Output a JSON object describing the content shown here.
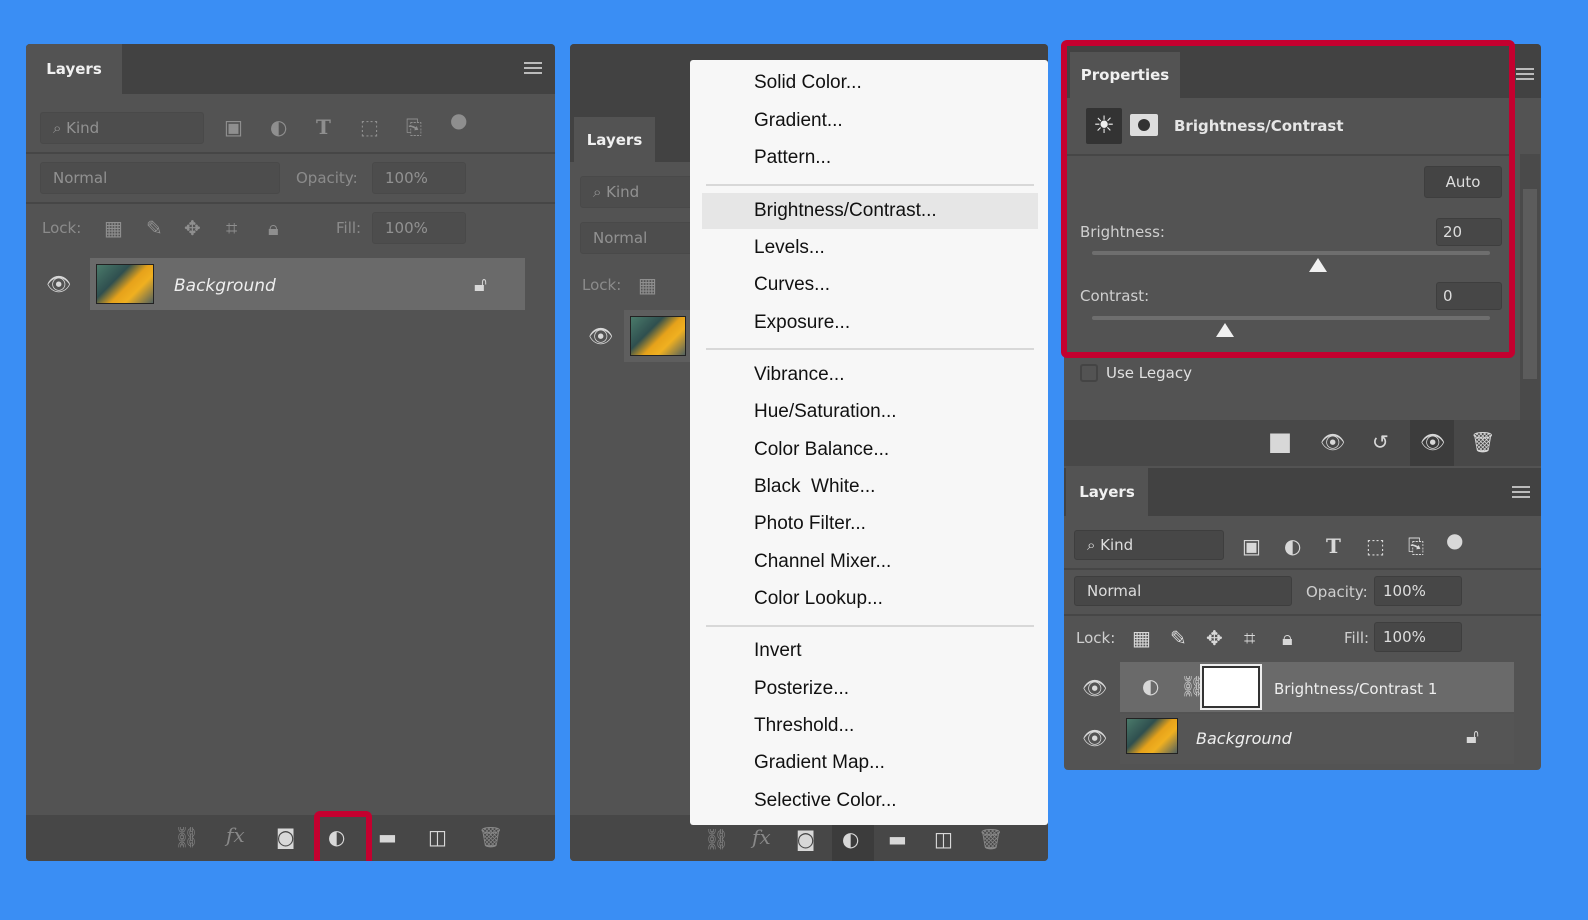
{
  "colors": {
    "background": "#3a8ef4",
    "highlight": "#c4002f",
    "panel": "#535353"
  },
  "left_panel": {
    "tab": "Layers",
    "filter": "Kind",
    "blend_mode": "Normal",
    "opacity_label": "Opacity:",
    "opacity": "100%",
    "lock_label": "Lock:",
    "fill_label": "Fill:",
    "fill": "100%",
    "layers": [
      {
        "name": "Background",
        "locked": true,
        "visible": true
      }
    ],
    "bottom_icons": [
      "link-icon",
      "fx-icon",
      "mask-icon",
      "adjustment-icon",
      "folder-icon",
      "new-layer-icon",
      "trash-icon"
    ],
    "fx": "fx"
  },
  "middle_panel": {
    "tab": "Layers",
    "filter": "Kind",
    "blend_mode": "Normal",
    "lock_label": "Lock:",
    "fx": "fx",
    "menu": {
      "groups": [
        [
          "Solid Color...",
          "Gradient...",
          "Pattern..."
        ],
        [
          "Brightness/Contrast...",
          "Levels...",
          "Curves...",
          "Exposure..."
        ],
        [
          "Vibrance...",
          "Hue/Saturation...",
          "Color Balance...",
          "Black  White...",
          "Photo Filter...",
          "Channel Mixer...",
          "Color Lookup..."
        ],
        [
          "Invert",
          "Posterize...",
          "Threshold...",
          "Gradient Map...",
          "Selective Color..."
        ]
      ],
      "hovered": "Brightness/Contrast..."
    }
  },
  "properties": {
    "tab": "Properties",
    "title": "Brightness/Contrast",
    "auto": "Auto",
    "brightness_label": "Brightness:",
    "brightness": "20",
    "contrast_label": "Contrast:",
    "contrast": "0",
    "use_legacy": "Use Legacy",
    "use_legacy_checked": false,
    "brightness_range": [
      -150,
      150
    ],
    "contrast_range": [
      -50,
      100
    ]
  },
  "right_layers": {
    "tab": "Layers",
    "filter": "Kind",
    "blend_mode": "Normal",
    "opacity_label": "Opacity:",
    "opacity": "100%",
    "lock_label": "Lock:",
    "fill_label": "Fill:",
    "fill": "100%",
    "layers": [
      {
        "name": "Brightness/Contrast 1",
        "selected": true
      },
      {
        "name": "Background",
        "locked": true
      }
    ]
  }
}
